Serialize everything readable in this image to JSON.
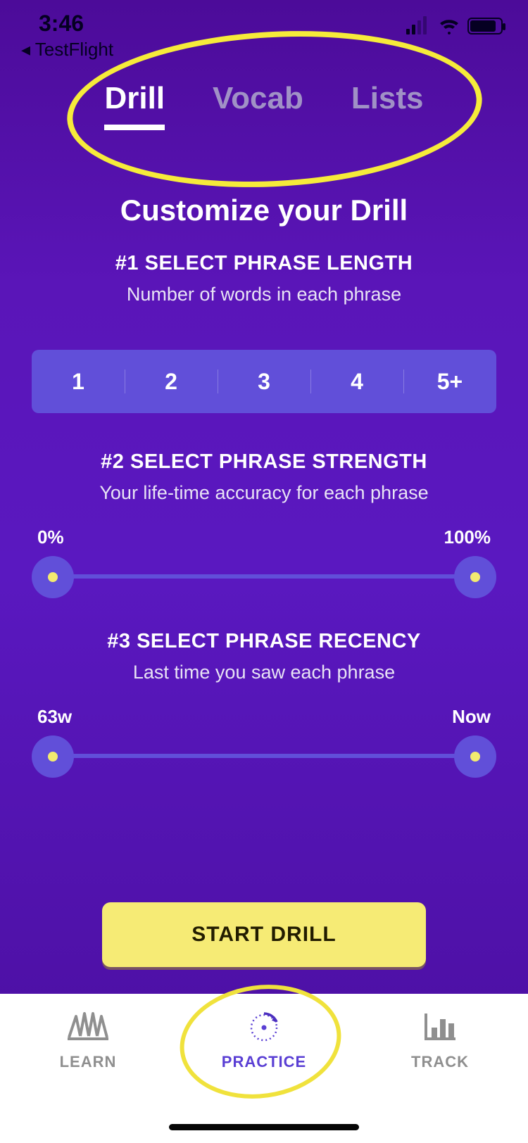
{
  "status": {
    "time": "3:46",
    "back_app": "◂ TestFlight"
  },
  "tabs": {
    "drill": "Drill",
    "vocab": "Vocab",
    "lists": "Lists"
  },
  "title": "Customize your Drill",
  "section1": {
    "heading": "#1 SELECT PHRASE LENGTH",
    "sub": "Number of words in each phrase",
    "options": [
      "1",
      "2",
      "3",
      "4",
      "5+"
    ]
  },
  "section2": {
    "heading": "#2 SELECT PHRASE STRENGTH",
    "sub": "Your life-time accuracy for each phrase",
    "min_label": "0%",
    "max_label": "100%"
  },
  "section3": {
    "heading": "#3 SELECT PHRASE RECENCY",
    "sub": "Last time you saw each phrase",
    "min_label": "63w",
    "max_label": "Now"
  },
  "cta": "START DRILL",
  "tabbar": {
    "learn": "LEARN",
    "practice": "PRACTICE",
    "track": "TRACK"
  }
}
